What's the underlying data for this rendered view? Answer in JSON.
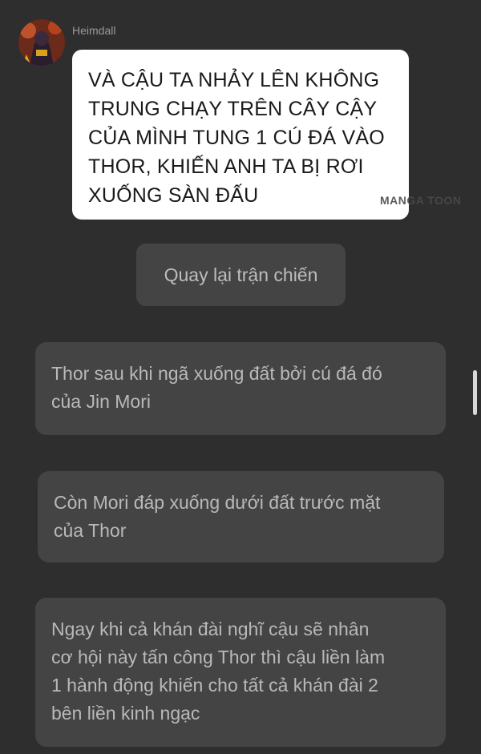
{
  "message": {
    "sender": "Heimdall",
    "text_lines": [
      "VÀ CẬU TA NHẢY LÊN KHÔNG",
      "TRUNG CHẠY TRÊN CÂY CẬY",
      "CỦA MÌNH TUNG 1 CÚ ĐÁ VÀO",
      "THOR, KHIẾN ANH TA BỊ RƠI",
      "XUỐNG SÀN ĐẤU"
    ]
  },
  "watermark": "MANGA TOON",
  "choice": {
    "label": "Quay lại trận chiến"
  },
  "narrations": [
    {
      "lines": [
        "Thor sau khi ngã xuống đất bởi cú đá đó",
        "của Jin Mori"
      ]
    },
    {
      "lines": [
        "Còn Mori đáp xuống dưới đất trước mặt",
        "của Thor"
      ]
    },
    {
      "lines": [
        "Ngay khi cả khán đài nghĩ cậu sẽ nhân",
        "cơ hội này tấn công Thor thì cậu liền làm",
        "1 hành động khiến cho tất cả khán đài 2",
        "bên liền kinh ngạc"
      ]
    }
  ],
  "colors": {
    "background": "#2e2e2e",
    "bubble": "#ffffff",
    "card": "#444444",
    "text_dark": "#1a1a1a",
    "text_muted": "#b9b9b9"
  },
  "icons": {
    "avatar": "character-avatar-icon"
  }
}
